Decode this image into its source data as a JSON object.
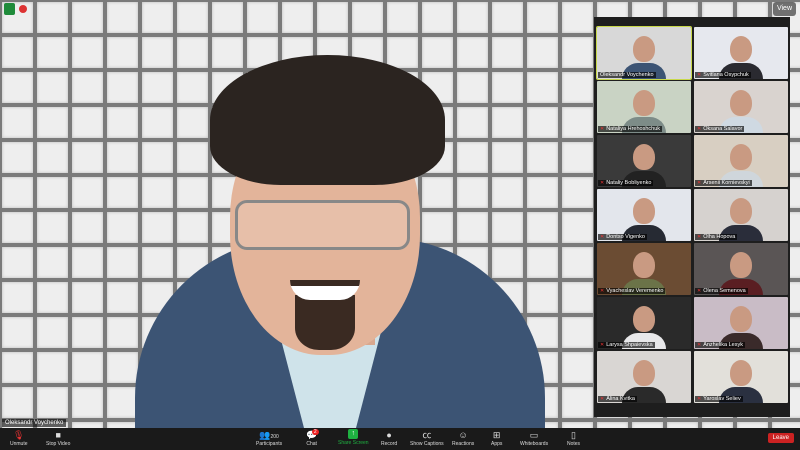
{
  "window": {
    "view_label": "View"
  },
  "main_video": {
    "speaker_name": "Oleksandr Voychenko"
  },
  "gallery": [
    {
      "name": "Oleksandr Voychenko",
      "bg": "#d8d8d8",
      "shirt": "#3c5474",
      "active": true
    },
    {
      "name": "Svitlana Osypchuk",
      "bg": "#e6e8ee",
      "shirt": "#2a2a30"
    },
    {
      "name": "Nataliya Hrehoshchuk",
      "bg": "#c9d3c4",
      "shirt": "#7d8c88"
    },
    {
      "name": "Oksana Salavor",
      "bg": "#d9d3cf",
      "shirt": "#cfd9e2"
    },
    {
      "name": "Nataliy Bobliyenko",
      "bg": "#3a3a3a",
      "shirt": "#222"
    },
    {
      "name": "Arsenii Kornievskyi",
      "bg": "#d8cfc2",
      "shirt": "#cfd6db"
    },
    {
      "name": "Dontso Vigenko",
      "bg": "#e3e6ec",
      "shirt": "#262a33"
    },
    {
      "name": "Olha Hopova",
      "bg": "#d6d2cf",
      "shirt": "#2a2d3a"
    },
    {
      "name": "Vyacheslav Veremenko",
      "bg": "#6b4c33",
      "shirt": "#6b7348"
    },
    {
      "name": "Olena Semenova",
      "bg": "#5a5555",
      "shirt": "#5a1e22"
    },
    {
      "name": "Larysa Shpaievska",
      "bg": "#2a2a2a",
      "shirt": "#e8e8ea"
    },
    {
      "name": "Anzhelika Lesyk",
      "bg": "#c9bcc6",
      "shirt": "#3a2a2a"
    },
    {
      "name": "Alina Kvitka",
      "bg": "#d9d6d3",
      "shirt": "#2a2a2a"
    },
    {
      "name": "Yaroslav Seliev",
      "bg": "#e2e0da",
      "shirt": "#2a3040"
    }
  ],
  "toolbar": {
    "unmute": "Unmute",
    "stop_video": "Stop Video",
    "participants": "Participants",
    "participants_count": "200",
    "chat": "Chat",
    "chat_badge": "2",
    "share_screen": "Share Screen",
    "record": "Record",
    "show_captions": "Show Captions",
    "reactions": "Reactions",
    "apps": "Apps",
    "whiteboards": "Whiteboards",
    "notes": "Notes",
    "leave": "Leave"
  }
}
